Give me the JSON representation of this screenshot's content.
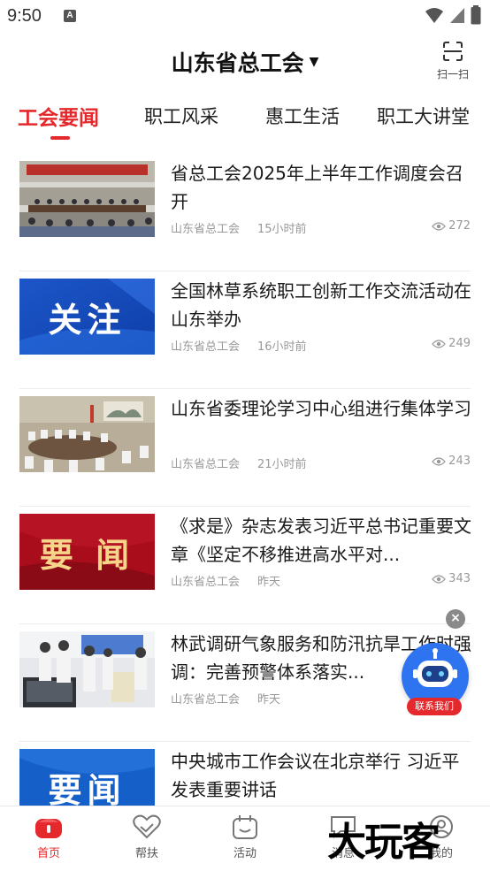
{
  "status_bar": {
    "time": "9:50",
    "notif_letter": "A"
  },
  "header": {
    "title": "山东省总工会",
    "scan_label": "扫一扫"
  },
  "tabs": [
    {
      "label": "工会要闻",
      "active": true
    },
    {
      "label": "职工风采",
      "active": false
    },
    {
      "label": "惠工生活",
      "active": false
    },
    {
      "label": "职工大讲堂",
      "active": false
    }
  ],
  "news": [
    {
      "title": "省总工会2025年上半年工作调度会召开",
      "source": "山东省总工会",
      "time": "15小时前",
      "views": "272",
      "thumb": "meeting-photo"
    },
    {
      "title": "全国林草系统职工创新工作交流活动在山东举办",
      "source": "山东省总工会",
      "time": "16小时前",
      "views": "249",
      "thumb": "attention-banner",
      "thumb_text": "关注"
    },
    {
      "title": "山东省委理论学习中心组进行集体学习",
      "source": "山东省总工会",
      "time": "21小时前",
      "views": "243",
      "thumb": "conference-photo"
    },
    {
      "title": "《求是》杂志发表习近平总书记重要文章《坚定不移推进高水平对...",
      "source": "山东省总工会",
      "time": "昨天",
      "views": "343",
      "thumb": "news-banner-red",
      "thumb_text": "要 闻"
    },
    {
      "title": "林武调研气象服务和防汛抗旱工作时强调：完善预警体系落实...",
      "source": "山东省总工会",
      "time": "昨天",
      "views": "",
      "thumb": "inspection-photo"
    },
    {
      "title": "中央城市工作会议在北京举行 习近平发表重要讲话",
      "source": "",
      "time": "",
      "views": "",
      "thumb": "news-banner-blue",
      "thumb_text": "要闻"
    }
  ],
  "float_bot": {
    "label": "联系我们"
  },
  "bottom_nav": [
    {
      "label": "首页",
      "icon": "home-icon",
      "active": true
    },
    {
      "label": "帮扶",
      "icon": "heart-hands-icon",
      "active": false
    },
    {
      "label": "活动",
      "icon": "activity-icon",
      "active": false
    },
    {
      "label": "消息",
      "icon": "message-icon",
      "active": false
    },
    {
      "label": "我的",
      "icon": "profile-icon",
      "active": false
    }
  ],
  "watermark": "大玩客",
  "colors": {
    "accent": "#e4282b",
    "bot_blue": "#2e73f0"
  }
}
